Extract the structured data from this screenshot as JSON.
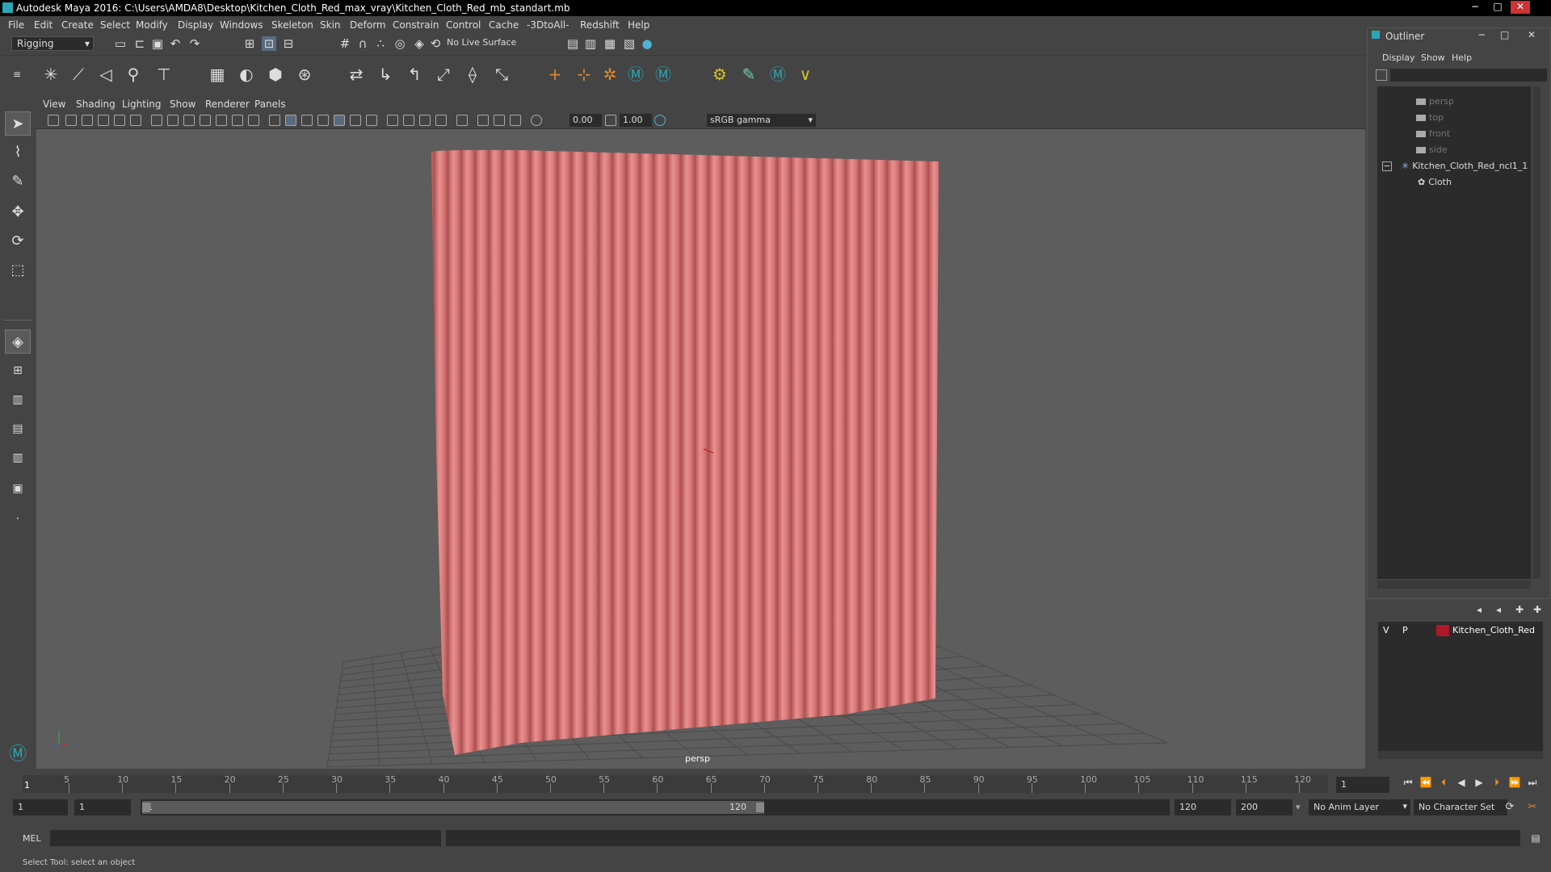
{
  "window": {
    "title": "Autodesk Maya 2016: C:\\Users\\AMDA8\\Desktop\\Kitchen_Cloth_Red_max_vray\\Kitchen_Cloth_Red_mb_standart.mb",
    "controls": {
      "minimize": "−",
      "maximize": "□",
      "close": "✕"
    }
  },
  "menubar": [
    "File",
    "Edit",
    "Create",
    "Select",
    "Modify",
    "Display",
    "Windows",
    "Skeleton",
    "Skin",
    "Deform",
    "Constrain",
    "Control",
    "Cache",
    "-3DtoAll-",
    "Redshift",
    "Help"
  ],
  "status_line": {
    "mode": "Rigging",
    "live_surface": "No Live Surface"
  },
  "viewport": {
    "menu": [
      "View",
      "Shading",
      "Lighting",
      "Show",
      "Renderer",
      "Panels"
    ],
    "exposure": "0.00",
    "gamma": "1.00",
    "color_space": "sRGB gamma",
    "camera_label": "persp",
    "cloth_color": "#d97878"
  },
  "outliner": {
    "title": "Outliner",
    "menu": [
      "Display",
      "Show",
      "Help"
    ],
    "items": [
      {
        "label": "persp",
        "type": "camera",
        "dim": true
      },
      {
        "label": "top",
        "type": "camera",
        "dim": true
      },
      {
        "label": "front",
        "type": "camera",
        "dim": true
      },
      {
        "label": "side",
        "type": "camera",
        "dim": true
      },
      {
        "label": "Kitchen_Cloth_Red_ncl1_1",
        "type": "ncloth",
        "dim": false
      },
      {
        "label": "Cloth",
        "type": "mesh",
        "dim": false
      }
    ]
  },
  "layers": {
    "v": "V",
    "p": "P",
    "name": "Kitchen_Cloth_Red",
    "color": "#b0182a"
  },
  "timeline": {
    "ticks": [
      "5",
      "10",
      "15",
      "20",
      "25",
      "30",
      "35",
      "40",
      "45",
      "50",
      "55",
      "60",
      "65",
      "70",
      "75",
      "80",
      "85",
      "90",
      "95",
      "100",
      "105",
      "110",
      "115",
      "120"
    ],
    "current_frame_ruler": "1",
    "current_frame": "1"
  },
  "range": {
    "start": "1",
    "playback_start": "1",
    "slider_start": "1",
    "slider_end": "120",
    "playback_end": "120",
    "end": "200",
    "anim_layer": "No Anim Layer",
    "character_set": "No Character Set"
  },
  "command": {
    "lang": "MEL"
  },
  "help_line": "Select Tool: select an object"
}
